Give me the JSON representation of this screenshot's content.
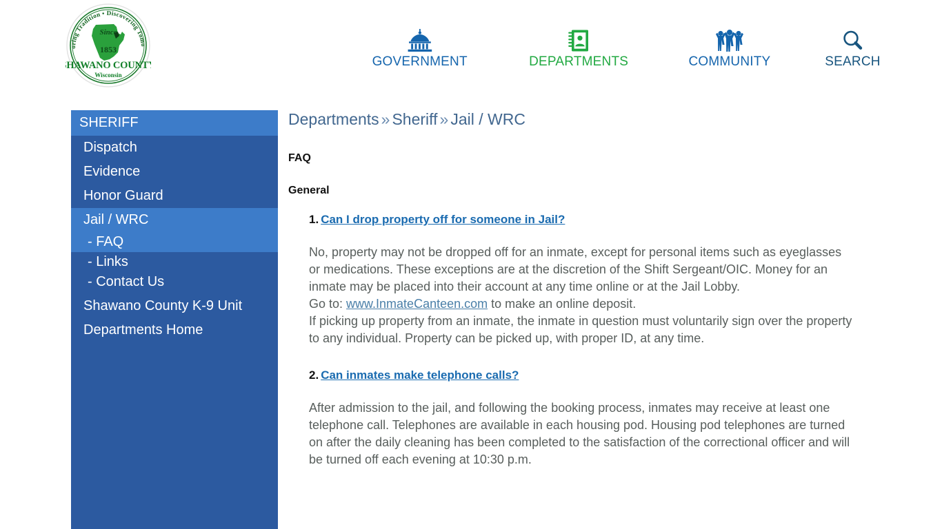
{
  "site": {
    "logo": {
      "top_arc_text": "Honoring Tradition • Discovering Tomorrow",
      "since_label": "Since",
      "year": "1853",
      "county_name": "SHAWANO COUNTY",
      "state": "Wisconsin",
      "green": "#2aa03c",
      "dark_green": "#127a2a"
    },
    "nav": [
      {
        "id": "government",
        "label": "GOVERNMENT",
        "icon": "capitol-building-icon",
        "color": "#1565ad",
        "active": false
      },
      {
        "id": "departments",
        "label": "DEPARTMENTS",
        "icon": "address-book-icon",
        "color": "#22a942",
        "active": true
      },
      {
        "id": "community",
        "label": "COMMUNITY",
        "icon": "three-people-icon",
        "color": "#1565ad",
        "active": false
      },
      {
        "id": "search",
        "label": "SEARCH",
        "icon": "magnifier-icon",
        "color": "#18557f",
        "active": false
      }
    ]
  },
  "sidebar": {
    "header": "SHERIFF",
    "items": [
      {
        "label": "Dispatch",
        "level": 1,
        "active": false
      },
      {
        "label": "Evidence",
        "level": 1,
        "active": false
      },
      {
        "label": "Honor Guard",
        "level": 1,
        "active": false
      },
      {
        "label": "Jail / WRC",
        "level": 1,
        "active": true
      },
      {
        "label": "- FAQ",
        "level": 2,
        "active": true
      },
      {
        "label": "- Links",
        "level": 2,
        "active": false
      },
      {
        "label": "- Contact Us",
        "level": 2,
        "active": false
      },
      {
        "label": "Shawano County K-9 Unit",
        "level": 1,
        "active": false
      },
      {
        "label": "Departments Home",
        "level": 1,
        "active": false
      }
    ]
  },
  "breadcrumb": {
    "items": [
      "Departments",
      "Sheriff",
      "Jail / WRC"
    ],
    "separator": "»"
  },
  "main": {
    "page_title": "FAQ",
    "section_heading": "General",
    "faqs": [
      {
        "number": "1.",
        "question": "Can I drop property off for someone in Jail?",
        "answer_lines": [
          "No, property may not be dropped off for an inmate, except for personal items such as eyeglasses or medications. These exceptions are at the discretion of the Shift Sergeant/OIC. Money for an inmate may be placed into their account at any time online or at the Jail Lobby.",
          "Go to: {link} to make an online deposit.",
          "If picking up property from an inmate, the inmate in question must voluntarily sign over the property to any individual. Property can be picked up, with proper ID, at any time."
        ],
        "inline_link": "www.InmateCanteen.com"
      },
      {
        "number": "2.",
        "question": "Can inmates make telephone calls?",
        "answer_lines": [
          "After admission to the jail, and following the booking process, inmates may receive at least one telephone call. Telephones are available in each housing pod. Housing pod telephones are turned on after the daily cleaning has been completed to the satisfaction of the correctional officer and will be turned off each evening at 10:30 p.m."
        ],
        "inline_link": ""
      }
    ]
  },
  "colors": {
    "sidebar_bg": "#2c5aa0",
    "sidebar_active": "#3d7cc9",
    "link_blue": "#1a6bb0",
    "breadcrumb_blue": "#42678f",
    "body_text": "#585e5c",
    "nav_blue": "#1565ad",
    "nav_green": "#22a942"
  }
}
